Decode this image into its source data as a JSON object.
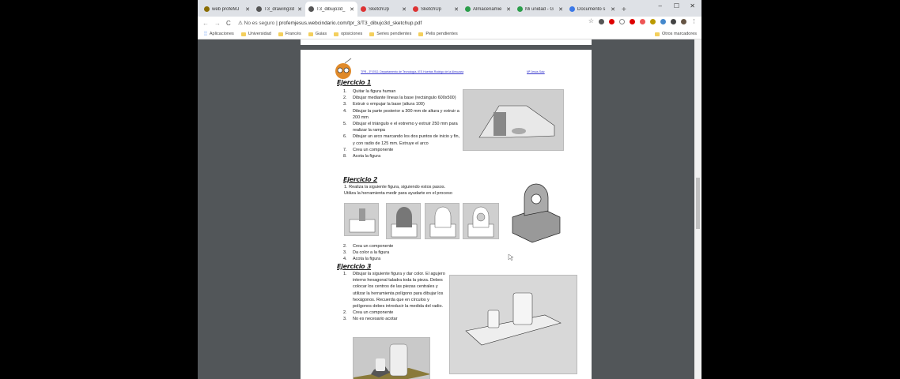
{
  "tabs": [
    {
      "label": "web profeMJ",
      "color": "#8a6d00"
    },
    {
      "label": "T3_drawing3d",
      "color": "#555"
    },
    {
      "label": "T3_dibujo3d_",
      "color": "#555",
      "active": true
    },
    {
      "label": "SketchUp",
      "color": "#d33"
    },
    {
      "label": "SketchUp",
      "color": "#d33"
    },
    {
      "label": "Almacenamie",
      "color": "#2a9d4a"
    },
    {
      "label": "Mi unidad - G",
      "color": "#2a9d4a"
    },
    {
      "label": "Documento s",
      "color": "#3b78e7"
    }
  ],
  "addressbar": {
    "security": "No es seguro",
    "url": "profemjesus.webcindario.com/tpr_3/T3_dibujo3d_sketchup.pdf"
  },
  "bookmarks": [
    "Aplicaciones",
    "Universidad",
    "Francés",
    "Guias",
    "opisiciones",
    "Series pendientes",
    "Pelis pendientes"
  ],
  "other_bookmarks": "Otros marcadores",
  "doc": {
    "header_left": "TPR - 3º ESO. Departamento de Tecnología. IES Huertas Rodrigo de la Almuzara",
    "header_right": "Mª Jesús Saiz",
    "ej1": {
      "title": "Ejercicio 1",
      "steps": [
        {
          "n": "1.",
          "t": "Quitar la figura human"
        },
        {
          "n": "2.",
          "t": "Dibujar mediante líneas la base (rectángulo 600x500)"
        },
        {
          "n": "3.",
          "t": "Extruir o empujar la base (altura 100)"
        },
        {
          "n": "4.",
          "t": "Dibujar la parte posterior a 300 mm de altura y extruir a 200 mm"
        },
        {
          "n": "5.",
          "t": "Dibujar el triángulo e el extremo y extruir 250 mm para realizar la rampa"
        },
        {
          "n": "6.",
          "t": "Dibujar un arco marcando los dos puntos de inicio y fin, y con radio de 125 mm. Extruye el arco"
        },
        {
          "n": "7.",
          "t": "Crea un componente"
        },
        {
          "n": "8.",
          "t": "Acota la figura"
        }
      ]
    },
    "ej2": {
      "title": "Ejercicio 2",
      "step1": "1.    Realiza la siguiente figura, siguiendo estos pasos.",
      "note": "Utiliza la herramienta medir para ayudarte en el proceso",
      "steps": [
        {
          "n": "2.",
          "t": "Crea un componente"
        },
        {
          "n": "3.",
          "t": "Da color a la figura"
        },
        {
          "n": "4.",
          "t": "Acota la figura"
        }
      ]
    },
    "ej3": {
      "title": "Ejercicio 3",
      "steps": [
        {
          "n": "1.",
          "t": "Dibujar la siguiente figura y dar color. El agujero interno hexagonal taladra toda la pieza. Debes colocar los centros de las piezas centrales y utilizar la herramienta polígono para dibujar los hexágonos. Recuerda que en círculos y polígonos debes introducir la medida del radio."
        },
        {
          "n": "2.",
          "t": "Crea un componente"
        },
        {
          "n": "3.",
          "t": "No es necesario acotar"
        }
      ]
    }
  }
}
